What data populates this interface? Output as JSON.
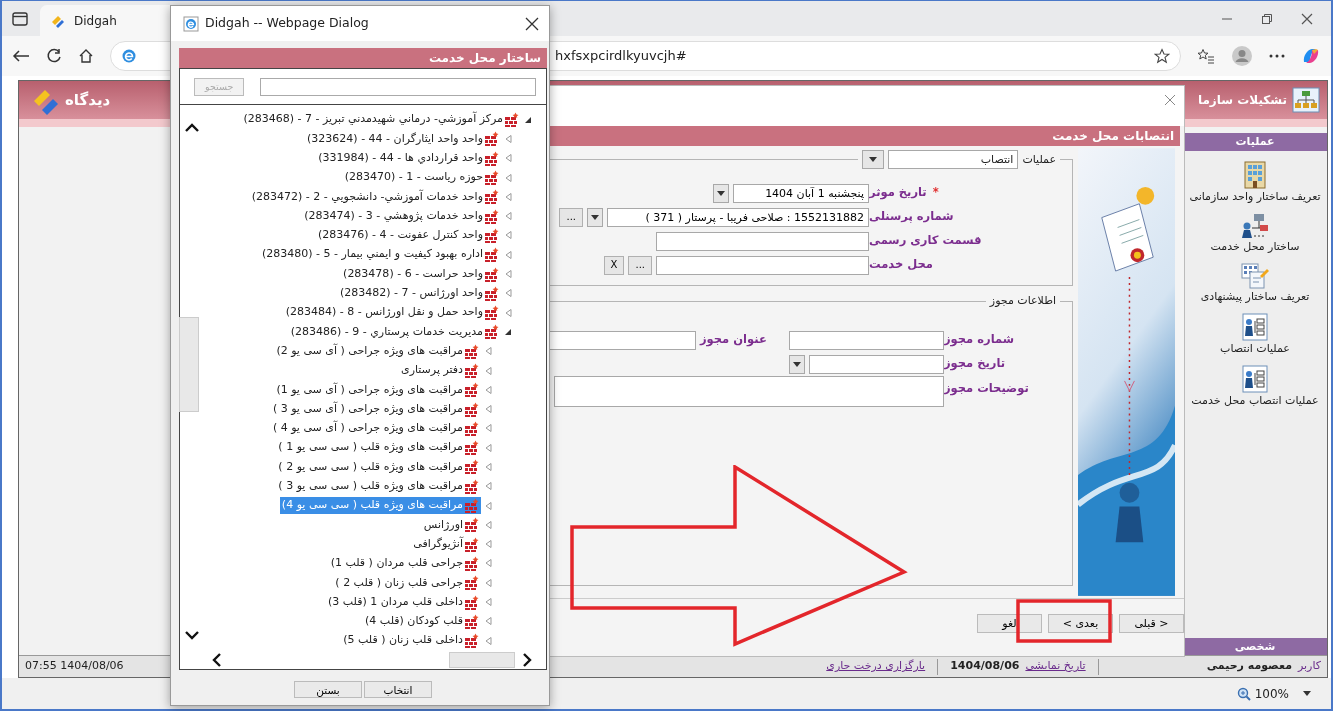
{
  "browser": {
    "tab_title": "Didgah",
    "address": "hxfsxpcirdlkyuvcjh#",
    "zoom": "100%"
  },
  "app": {
    "logo": "دیدگاه",
    "title": "تشکیلات سازما",
    "sidebar": {
      "header": "عملیات",
      "footer": "شخصی",
      "items": [
        {
          "label": "تعریف ساختار واحد سازمانی",
          "kind": "building"
        },
        {
          "label": "ساختار محل خدمت",
          "kind": "org-chart"
        },
        {
          "label": "تعریف ساختار پیشنهادی",
          "kind": "grid-pencil"
        },
        {
          "label": "عملیات انتصاب",
          "kind": "person-list"
        },
        {
          "label": "عملیات انتصاب محل خدمت",
          "kind": "person-list"
        }
      ]
    },
    "status_bar": {
      "datetime": "1404/08/06 07:55",
      "reload_link": "بارگزاری درخت جاری",
      "display_date": "1404/08/06",
      "display_date_link": "تاریخ نمایشی",
      "user_label": "کاربر",
      "user_name": "معصومه رحیمی"
    }
  },
  "modal": {
    "title": "انتصابات محل خدمت",
    "operation": {
      "label": "عملیات",
      "value": "انتصاب"
    },
    "fields": [
      {
        "label": "تاریخ موثر",
        "mark": "*",
        "kind": "date",
        "value": "پنجشنبه 1 آبان 1404"
      },
      {
        "label": "شماره پرسنلی",
        "kind": "lookup",
        "value": "1552131882 : صلاحی فریبا - پرستار ( 371 )",
        "buttons": [
          "..."
        ]
      },
      {
        "label": "قسمت کاری رسمی",
        "kind": "text"
      },
      {
        "label": "محل خدمت",
        "kind": "lookup",
        "buttons": [
          "...",
          "X"
        ]
      }
    ],
    "license": {
      "legend": "اطلاعات مجوز",
      "number_label": "شماره مجوز",
      "title_label": "عنوان مجوز",
      "date_label": "تاریخ مجوز",
      "notes_label": "توضیحات مجوز"
    },
    "buttons": [
      {
        "label": "< قبلی"
      },
      {
        "label": "بعدی >"
      },
      {
        "label": "لغو"
      }
    ]
  },
  "dialog": {
    "title": "Didgah -- Webpage Dialog",
    "header": "ساختار محل خدمت",
    "search": {
      "button": "جستجو",
      "disabled": true
    },
    "tree": [
      {
        "label": "مرکز آموزشي- درماني شهيدمدني تبريز - 7 - (283468)",
        "expanded": true,
        "selected": false,
        "children": [
          {
            "label": "واحد واحد ایثارگران - 44 - (323624)",
            "expanded": false,
            "selected": false
          },
          {
            "label": "واحد قراردادي ها - 44 - (331984)",
            "expanded": false,
            "selected": false
          },
          {
            "label": "حوزه رياست - 1 - (283470)",
            "expanded": false,
            "selected": false
          },
          {
            "label": "واحد خدمات آموزشي- دانشجويي - 2 - (283472)",
            "expanded": false,
            "selected": false
          },
          {
            "label": "واحد خدمات پژوهشي - 3 - (283474)",
            "expanded": false,
            "selected": false
          },
          {
            "label": "واحد کنترل عفونت - 4 - (283476)",
            "expanded": false,
            "selected": false
          },
          {
            "label": "اداره بهبود کيفيت و ايمني بيمار - 5 - (283480)",
            "expanded": false,
            "selected": false
          },
          {
            "label": "واحد حراست - 6 - (283478)",
            "expanded": false,
            "selected": false
          },
          {
            "label": "واحد اورژانس - 7 - (283482)",
            "expanded": false,
            "selected": false
          },
          {
            "label": "واحد حمل و نقل اورژانس - 8 - (283484)",
            "expanded": false,
            "selected": false
          },
          {
            "label": "مديريت خدمات پرستاري - 9 - (283486)",
            "expanded": true,
            "selected": false,
            "children": [
              {
                "label": "مراقبت های ویژه جراحی ( آی سی یو 2)",
                "expanded": false,
                "selected": false
              },
              {
                "label": "دفتر پرستاری",
                "expanded": false,
                "selected": false
              },
              {
                "label": "مراقبت های ویژه جراحی ( آی سی یو 1)",
                "expanded": false,
                "selected": false
              },
              {
                "label": "مراقبت های ویژه جراحی ( آی سی یو 3 )",
                "expanded": false,
                "selected": false
              },
              {
                "label": "مراقبت های ویژه جراحی ( آی سی یو 4 )",
                "expanded": false,
                "selected": false
              },
              {
                "label": "مراقبت های ویژه قلب ( سی سی یو 1 )",
                "expanded": false,
                "selected": false
              },
              {
                "label": "مراقبت های ویژه قلب ( سی سی یو 2 )",
                "expanded": false,
                "selected": false
              },
              {
                "label": "مراقبت های ویژه قلب ( سی سی یو 3 )",
                "expanded": false,
                "selected": false
              },
              {
                "label": "مراقبت های ویژه قلب ( سی سی یو 4)",
                "expanded": false,
                "selected": true
              },
              {
                "label": "اورژانس",
                "expanded": false,
                "selected": false
              },
              {
                "label": "آنژیوگرافی",
                "expanded": false,
                "selected": false
              },
              {
                "label": "جراحی قلب مردان ( قلب 1)",
                "expanded": false,
                "selected": false
              },
              {
                "label": "جراحی قلب زنان ( قلب 2 )",
                "expanded": false,
                "selected": false
              },
              {
                "label": "داخلی قلب مردان 1 (قلب 3)",
                "expanded": false,
                "selected": false
              },
              {
                "label": "قلب کودکان (قلب 4)",
                "expanded": false,
                "selected": false
              },
              {
                "label": "داخلی قلب زنان ( قلب 5)",
                "expanded": false,
                "selected": false
              }
            ]
          }
        ]
      }
    ],
    "buttons": [
      {
        "label": "انتخاب"
      },
      {
        "label": "بستن"
      }
    ]
  },
  "annotations": [
    {
      "kind": "arrow"
    },
    {
      "kind": "highlight"
    }
  ]
}
